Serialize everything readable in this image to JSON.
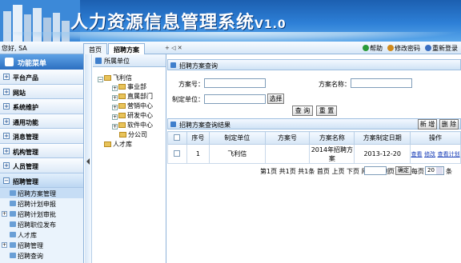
{
  "banner": {
    "title": "人力资源信息管理系统",
    "version": "V1.0"
  },
  "topbar": {
    "greeting": "您好, SA",
    "tabs": [
      {
        "label": "首页"
      },
      {
        "label": "招聘方案"
      }
    ],
    "tab_controls": "+ ◁ ✕",
    "links": {
      "help": "帮助",
      "change_password": "修改密码",
      "relogin": "重新登录"
    }
  },
  "left_menu": {
    "title": "功能菜单",
    "items": [
      {
        "label": "平台产品"
      },
      {
        "label": "网站"
      },
      {
        "label": "系统维护"
      },
      {
        "label": "通用功能"
      },
      {
        "label": "消息管理"
      },
      {
        "label": "机构管理"
      },
      {
        "label": "人员管理"
      },
      {
        "label": "招聘管理"
      }
    ],
    "sub_items": [
      {
        "label": "招聘方案管理"
      },
      {
        "label": "招聘计划申报"
      },
      {
        "label": "招聘计划审批"
      },
      {
        "label": "招聘职位发布"
      },
      {
        "label": "人才库"
      },
      {
        "label": "招聘管理"
      },
      {
        "label": "招聘查询"
      }
    ]
  },
  "tree": {
    "title": "所属单位",
    "root": "飞利信",
    "children": [
      "事业部",
      "直属部门",
      "营销中心",
      "研发中心",
      "软件中心",
      "分公司"
    ],
    "talent": "人才库"
  },
  "query": {
    "title": "招聘方案查询",
    "plan_no_label": "方案号：",
    "plan_name_label": "方案名称：",
    "unit_label": "制定单位：",
    "select_button": "选择",
    "query_button": "查 询",
    "reset_button": "重 置"
  },
  "results": {
    "title": "招聘方案查询结果",
    "new_button": "新 增",
    "delete_button": "删 除",
    "columns": [
      "",
      "序号",
      "制定单位",
      "方案号",
      "方案名称",
      "方案制定日期",
      "操作"
    ],
    "rows": [
      {
        "index": "1",
        "unit": "飞利信",
        "plan_no": "",
        "plan_name": "2014年招聘方案",
        "date": "2013-12-20",
        "ops": [
          "查看",
          "修改",
          "查看计划"
        ]
      }
    ]
  },
  "pager": {
    "summary": "第1页 共1页 共1条 首页 上页 下页 尾页 转到",
    "goto_unit": "页",
    "confirm": "确定",
    "per_page_label": "每页",
    "per_page_value": "20",
    "per_page_unit": "条"
  }
}
